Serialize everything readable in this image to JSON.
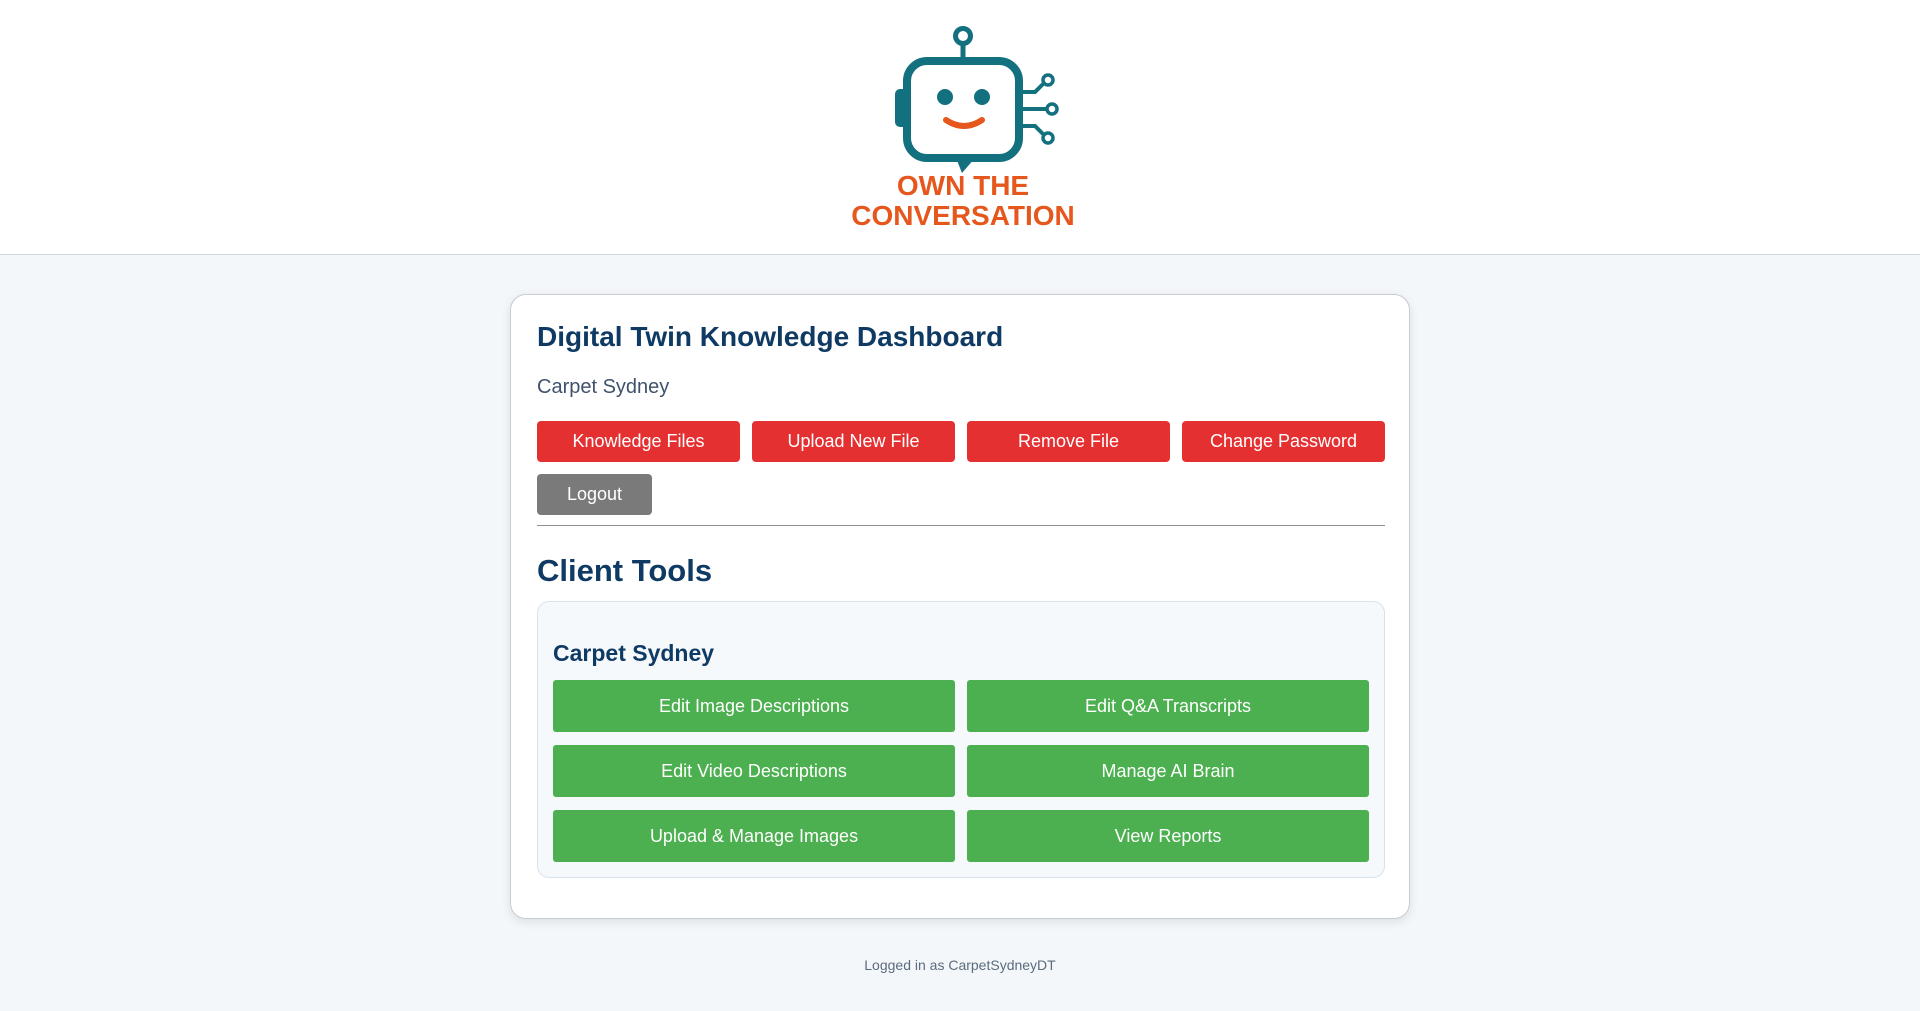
{
  "brand": {
    "line1": "OWN THE",
    "line2": "CONVERSATION",
    "teal": "#13707f",
    "orange": "#e5571d"
  },
  "dashboard": {
    "title": "Digital Twin Knowledge Dashboard",
    "client_name": "Carpet Sydney",
    "buttons": {
      "knowledge_files": "Knowledge Files",
      "upload_new_file": "Upload New File",
      "remove_file": "Remove File",
      "change_password": "Change Password",
      "logout": "Logout"
    }
  },
  "client_tools": {
    "title": "Client Tools",
    "client_name": "Carpet Sydney",
    "buttons": {
      "edit_image_descriptions": "Edit Image Descriptions",
      "edit_qa_transcripts": "Edit Q&A Transcripts",
      "edit_video_descriptions": "Edit Video Descriptions",
      "manage_ai_brain": "Manage AI Brain",
      "upload_manage_images": "Upload & Manage Images",
      "view_reports": "View Reports"
    }
  },
  "footer": {
    "logged_in_text": "Logged in as CarpetSydneyDT"
  },
  "colors": {
    "primary_red": "#e53032",
    "logout_gray": "#7a7a7a",
    "tool_green": "#4caf50",
    "heading_navy": "#0f3a63"
  }
}
